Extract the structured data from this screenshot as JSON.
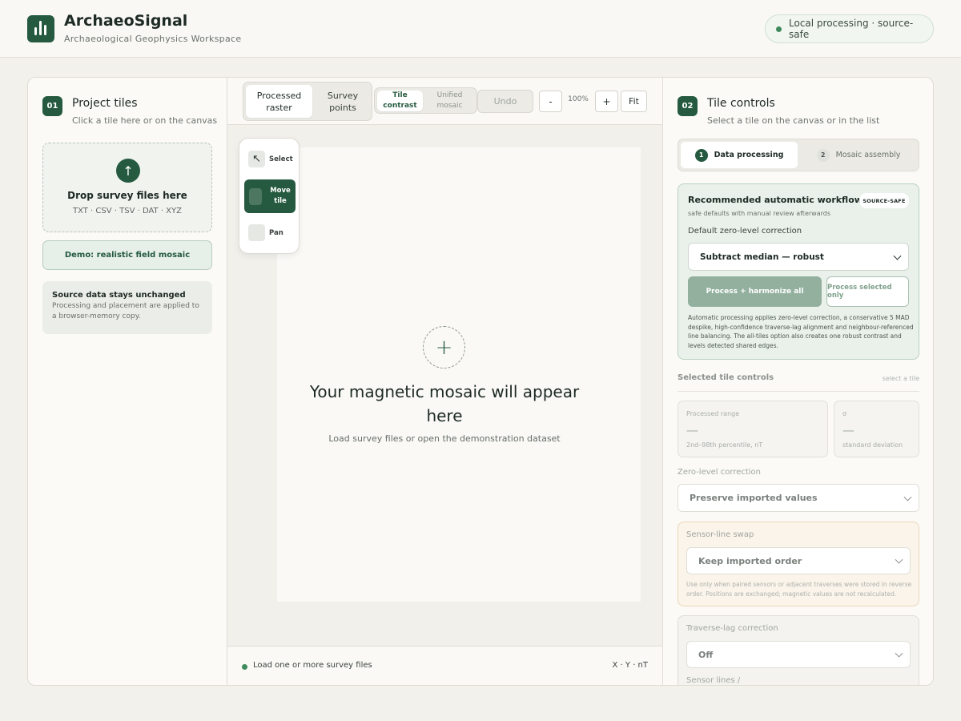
{
  "header": {
    "app_title": "ArchaeoSignal",
    "app_subtitle": "Archaeological Geophysics Workspace",
    "status": "Local processing · source-safe",
    "status_color": "#3e8a5c"
  },
  "left": {
    "step": "01",
    "title": "Project tiles",
    "subtitle": "Click a tile here or on the canvas",
    "drop_title": "Drop survey files here",
    "drop_formats": "TXT · CSV · TSV · DAT · XYZ",
    "demo_button": "Demo: realistic field mosaic",
    "note_title": "Source data stays unchanged",
    "note_body": "Processing and placement are applied to a browser-memory copy."
  },
  "toolbar": {
    "view_modes": [
      "Processed raster",
      "Survey points"
    ],
    "contrast_modes": [
      "Tile contrast",
      "Unified mosaic"
    ],
    "undo": "Undo",
    "zoom_out": "-",
    "zoom": "100%",
    "zoom_in": "+",
    "fit": "Fit"
  },
  "tools": {
    "select": "Select",
    "move_tile": "Move tile",
    "pan": "Pan"
  },
  "canvas": {
    "empty_title": "Your magnetic mosaic will appear here",
    "empty_sub": "Load survey files or open the demonstration dataset"
  },
  "statusbar": {
    "message": "Load one or more survey files",
    "coords": "X · Y · nT"
  },
  "right": {
    "step": "02",
    "title": "Tile controls",
    "subtitle": "Select a tile on the canvas or in the list",
    "tabs": [
      {
        "num": "1",
        "label": "Data processing"
      },
      {
        "num": "2",
        "label": "Mosaic assembly"
      }
    ],
    "auto": {
      "title": "Recommended automatic workflow",
      "badge": "SOURCE-SAFE",
      "subtitle": "safe defaults with manual review afterwards",
      "label": "Default zero-level correction",
      "selected": "Subtract median — robust",
      "process_all": "Process + harmonize all",
      "process_selected": "Process selected only",
      "description": "Automatic processing applies zero-level correction, a conservative 5 MAD despike, high-confidence traverse-lag alignment and neighbour-referenced line balancing. The all-tiles option also creates one robust contrast and levels detected shared edges."
    },
    "selected_controls": "Selected tile controls",
    "selected_hint": "select a tile",
    "stats": [
      {
        "label": "Processed range",
        "value": "—",
        "desc": "2nd–98th percentile, nT"
      },
      {
        "label": "σ",
        "value": "—",
        "desc": "standard deviation"
      }
    ],
    "zero_label": "Zero-level correction",
    "zero_value": "Preserve imported values",
    "swap_label": "Sensor-line swap",
    "swap_value": "Keep imported order",
    "swap_desc": "Use only when paired sensors or adjacent traverses were stored in reverse order. Positions are exchanged; magnetic values are not recalculated.",
    "lag_label": "Traverse-lag correction",
    "lag_value": "Off",
    "sensor_lines_label": "Sensor lines /"
  }
}
